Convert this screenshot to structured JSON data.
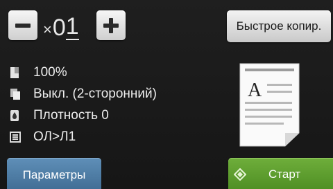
{
  "copies": {
    "prefix": "×",
    "value_head": "0",
    "value_tail": "1",
    "decrement_icon": "minus-icon",
    "increment_icon": "plus-icon"
  },
  "quick_copy_label": "Быстрое копир.",
  "settings": [
    {
      "icon": "page-size-icon",
      "text": "100%"
    },
    {
      "icon": "duplex-icon",
      "text": "Выкл. (2-сторонний)"
    },
    {
      "icon": "density-icon",
      "text": "Плотность 0"
    },
    {
      "icon": "layout-icon",
      "text": "ОЛ>Л1"
    }
  ],
  "preview": {
    "letter": "A"
  },
  "footer": {
    "options_label": "Параметры",
    "start_label": "Старт",
    "start_icon": "diamond-icon"
  },
  "colors": {
    "options_button": "#4f7ea6",
    "start_button": "#5c9e2e",
    "background": "#1b1b1b"
  }
}
